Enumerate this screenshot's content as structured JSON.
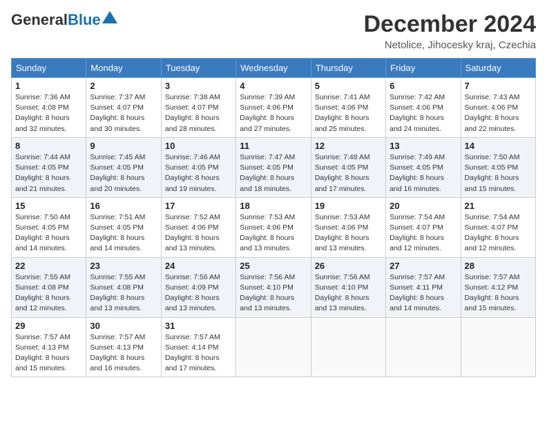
{
  "header": {
    "logo_general": "General",
    "logo_blue": "Blue",
    "month_title": "December 2024",
    "location": "Netolice, Jihocesky kraj, Czechia"
  },
  "days_of_week": [
    "Sunday",
    "Monday",
    "Tuesday",
    "Wednesday",
    "Thursday",
    "Friday",
    "Saturday"
  ],
  "weeks": [
    [
      {
        "day": "1",
        "sunrise": "Sunrise: 7:36 AM",
        "sunset": "Sunset: 4:08 PM",
        "daylight": "Daylight: 8 hours and 32 minutes."
      },
      {
        "day": "2",
        "sunrise": "Sunrise: 7:37 AM",
        "sunset": "Sunset: 4:07 PM",
        "daylight": "Daylight: 8 hours and 30 minutes."
      },
      {
        "day": "3",
        "sunrise": "Sunrise: 7:38 AM",
        "sunset": "Sunset: 4:07 PM",
        "daylight": "Daylight: 8 hours and 28 minutes."
      },
      {
        "day": "4",
        "sunrise": "Sunrise: 7:39 AM",
        "sunset": "Sunset: 4:06 PM",
        "daylight": "Daylight: 8 hours and 27 minutes."
      },
      {
        "day": "5",
        "sunrise": "Sunrise: 7:41 AM",
        "sunset": "Sunset: 4:06 PM",
        "daylight": "Daylight: 8 hours and 25 minutes."
      },
      {
        "day": "6",
        "sunrise": "Sunrise: 7:42 AM",
        "sunset": "Sunset: 4:06 PM",
        "daylight": "Daylight: 8 hours and 24 minutes."
      },
      {
        "day": "7",
        "sunrise": "Sunrise: 7:43 AM",
        "sunset": "Sunset: 4:06 PM",
        "daylight": "Daylight: 8 hours and 22 minutes."
      }
    ],
    [
      {
        "day": "8",
        "sunrise": "Sunrise: 7:44 AM",
        "sunset": "Sunset: 4:05 PM",
        "daylight": "Daylight: 8 hours and 21 minutes."
      },
      {
        "day": "9",
        "sunrise": "Sunrise: 7:45 AM",
        "sunset": "Sunset: 4:05 PM",
        "daylight": "Daylight: 8 hours and 20 minutes."
      },
      {
        "day": "10",
        "sunrise": "Sunrise: 7:46 AM",
        "sunset": "Sunset: 4:05 PM",
        "daylight": "Daylight: 8 hours and 19 minutes."
      },
      {
        "day": "11",
        "sunrise": "Sunrise: 7:47 AM",
        "sunset": "Sunset: 4:05 PM",
        "daylight": "Daylight: 8 hours and 18 minutes."
      },
      {
        "day": "12",
        "sunrise": "Sunrise: 7:48 AM",
        "sunset": "Sunset: 4:05 PM",
        "daylight": "Daylight: 8 hours and 17 minutes."
      },
      {
        "day": "13",
        "sunrise": "Sunrise: 7:49 AM",
        "sunset": "Sunset: 4:05 PM",
        "daylight": "Daylight: 8 hours and 16 minutes."
      },
      {
        "day": "14",
        "sunrise": "Sunrise: 7:50 AM",
        "sunset": "Sunset: 4:05 PM",
        "daylight": "Daylight: 8 hours and 15 minutes."
      }
    ],
    [
      {
        "day": "15",
        "sunrise": "Sunrise: 7:50 AM",
        "sunset": "Sunset: 4:05 PM",
        "daylight": "Daylight: 8 hours and 14 minutes."
      },
      {
        "day": "16",
        "sunrise": "Sunrise: 7:51 AM",
        "sunset": "Sunset: 4:05 PM",
        "daylight": "Daylight: 8 hours and 14 minutes."
      },
      {
        "day": "17",
        "sunrise": "Sunrise: 7:52 AM",
        "sunset": "Sunset: 4:06 PM",
        "daylight": "Daylight: 8 hours and 13 minutes."
      },
      {
        "day": "18",
        "sunrise": "Sunrise: 7:53 AM",
        "sunset": "Sunset: 4:06 PM",
        "daylight": "Daylight: 8 hours and 13 minutes."
      },
      {
        "day": "19",
        "sunrise": "Sunrise: 7:53 AM",
        "sunset": "Sunset: 4:06 PM",
        "daylight": "Daylight: 8 hours and 13 minutes."
      },
      {
        "day": "20",
        "sunrise": "Sunrise: 7:54 AM",
        "sunset": "Sunset: 4:07 PM",
        "daylight": "Daylight: 8 hours and 12 minutes."
      },
      {
        "day": "21",
        "sunrise": "Sunrise: 7:54 AM",
        "sunset": "Sunset: 4:07 PM",
        "daylight": "Daylight: 8 hours and 12 minutes."
      }
    ],
    [
      {
        "day": "22",
        "sunrise": "Sunrise: 7:55 AM",
        "sunset": "Sunset: 4:08 PM",
        "daylight": "Daylight: 8 hours and 12 minutes."
      },
      {
        "day": "23",
        "sunrise": "Sunrise: 7:55 AM",
        "sunset": "Sunset: 4:08 PM",
        "daylight": "Daylight: 8 hours and 13 minutes."
      },
      {
        "day": "24",
        "sunrise": "Sunrise: 7:56 AM",
        "sunset": "Sunset: 4:09 PM",
        "daylight": "Daylight: 8 hours and 13 minutes."
      },
      {
        "day": "25",
        "sunrise": "Sunrise: 7:56 AM",
        "sunset": "Sunset: 4:10 PM",
        "daylight": "Daylight: 8 hours and 13 minutes."
      },
      {
        "day": "26",
        "sunrise": "Sunrise: 7:56 AM",
        "sunset": "Sunset: 4:10 PM",
        "daylight": "Daylight: 8 hours and 13 minutes."
      },
      {
        "day": "27",
        "sunrise": "Sunrise: 7:57 AM",
        "sunset": "Sunset: 4:11 PM",
        "daylight": "Daylight: 8 hours and 14 minutes."
      },
      {
        "day": "28",
        "sunrise": "Sunrise: 7:57 AM",
        "sunset": "Sunset: 4:12 PM",
        "daylight": "Daylight: 8 hours and 15 minutes."
      }
    ],
    [
      {
        "day": "29",
        "sunrise": "Sunrise: 7:57 AM",
        "sunset": "Sunset: 4:13 PM",
        "daylight": "Daylight: 8 hours and 15 minutes."
      },
      {
        "day": "30",
        "sunrise": "Sunrise: 7:57 AM",
        "sunset": "Sunset: 4:13 PM",
        "daylight": "Daylight: 8 hours and 16 minutes."
      },
      {
        "day": "31",
        "sunrise": "Sunrise: 7:57 AM",
        "sunset": "Sunset: 4:14 PM",
        "daylight": "Daylight: 8 hours and 17 minutes."
      },
      null,
      null,
      null,
      null
    ]
  ]
}
